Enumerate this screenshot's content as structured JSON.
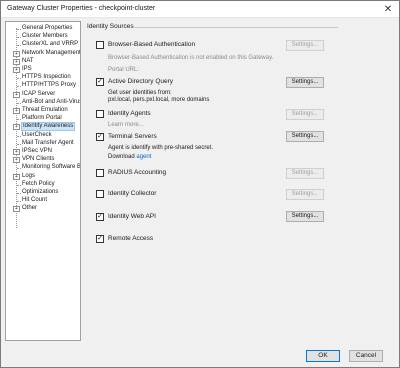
{
  "window": {
    "title": "Gateway Cluster Properties - checkpoint-cluster"
  },
  "tree": {
    "items": [
      {
        "label": "General Properties",
        "expandable": false
      },
      {
        "label": "Cluster Members",
        "expandable": false
      },
      {
        "label": "ClusterXL and VRRP",
        "expandable": false
      },
      {
        "label": "Network Management",
        "expandable": true
      },
      {
        "label": "NAT",
        "expandable": true
      },
      {
        "label": "IPS",
        "expandable": true
      },
      {
        "label": "HTTPS Inspection",
        "expandable": false
      },
      {
        "label": "HTTP/HTTPS Proxy",
        "expandable": false
      },
      {
        "label": "ICAP Server",
        "expandable": true
      },
      {
        "label": "Anti-Bot and Anti-Virus",
        "expandable": false
      },
      {
        "label": "Threat Emulation",
        "expandable": true
      },
      {
        "label": "Platform Portal",
        "expandable": false
      },
      {
        "label": "Identity Awareness",
        "expandable": true,
        "selected": true
      },
      {
        "label": "UserCheck",
        "expandable": false
      },
      {
        "label": "Mail Transfer Agent",
        "expandable": false
      },
      {
        "label": "IPSec VPN",
        "expandable": true
      },
      {
        "label": "VPN Clients",
        "expandable": true
      },
      {
        "label": "Monitoring Software Bla",
        "expandable": false
      },
      {
        "label": "Logs",
        "expandable": true
      },
      {
        "label": "Fetch Policy",
        "expandable": false
      },
      {
        "label": "Optimizations",
        "expandable": false
      },
      {
        "label": "Hit Count",
        "expandable": false
      },
      {
        "label": "Other",
        "expandable": true
      }
    ]
  },
  "identity_sources": {
    "group_title": "Identity Sources",
    "browser_auth": {
      "label": "Browser-Based Authentication",
      "checked": false,
      "settings": "Settings...",
      "note": "Browser-Based Authentication is not enabled on this Gateway.",
      "portal_url": "Portal URL:"
    },
    "ad_query": {
      "label": "Active Directory Query",
      "checked": true,
      "settings": "Settings...",
      "line1": "Get user identities from:",
      "line2": "pxl.local, pers.pxl.local, more domains"
    },
    "identity_agents": {
      "label": "Identity Agents",
      "checked": false,
      "settings": "Settings...",
      "learn_more": "Learn more..."
    },
    "terminal_servers": {
      "label": "Terminal Servers",
      "checked": true,
      "settings": "Settings...",
      "line1": "Agent is identify with pre-shared secret.",
      "download": "Download",
      "agent_link": "agent"
    },
    "radius": {
      "label": "RADIUS Accounting",
      "checked": false,
      "settings": "Settings..."
    },
    "identity_collector": {
      "label": "Identity Collector",
      "checked": false,
      "settings": "Settings..."
    },
    "identity_web_api": {
      "label": "Identity Web API",
      "checked": true,
      "settings": "Settings..."
    },
    "remote_access": {
      "label": "Remote Access",
      "checked": true
    }
  },
  "footer": {
    "ok": "OK",
    "cancel": "Cancel"
  },
  "icons": {
    "check": "✓",
    "close": "✕",
    "expand": "+"
  },
  "colors": {
    "link": "#0066cc",
    "selection": "#cce4f7",
    "primary_border": "#0078d7"
  }
}
